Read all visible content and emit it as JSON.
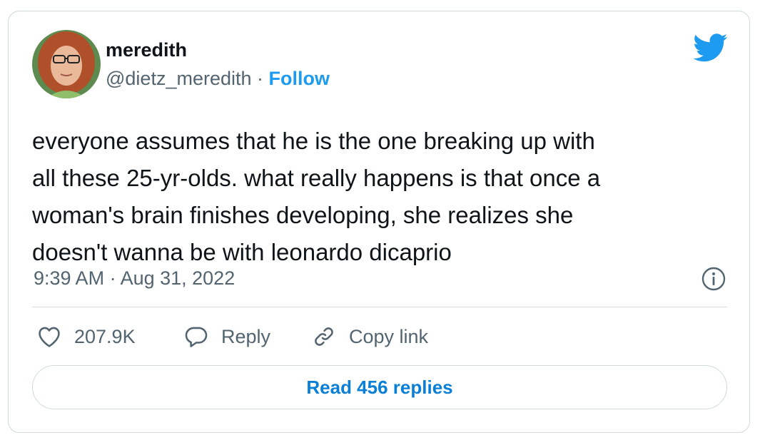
{
  "author": {
    "name": "meredith",
    "handle": "@dietz_meredith",
    "separator": "·",
    "follow_label": "Follow",
    "avatar_icon": "profile-photo"
  },
  "brand": {
    "icon": "twitter-bird-icon",
    "color": "#1d9bf0"
  },
  "tweet": {
    "lines": [
      "everyone assumes that he is the one breaking up with",
      "all these 25-yr-olds. what really happens is that once a",
      "woman's brain finishes developing, she realizes she",
      "doesn't wanna be with leonardo dicaprio"
    ],
    "timestamp": "9:39 AM · Aug 31, 2022",
    "info_icon": "info-icon"
  },
  "actions": {
    "like_count": "207.9K",
    "reply_label": "Reply",
    "copy_link_label": "Copy link"
  },
  "read_replies_label": "Read 456 replies"
}
